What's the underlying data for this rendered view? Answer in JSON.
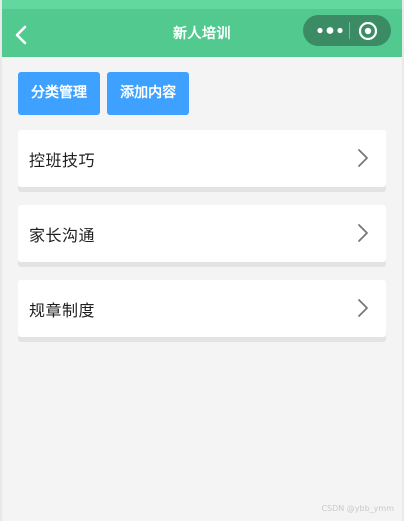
{
  "navbar": {
    "title": "新人培训",
    "back_icon": "chevron-left-icon",
    "more_icon": "more-dots-icon",
    "target_icon": "target-icon",
    "background": "#52c98f"
  },
  "actions": [
    {
      "label": "分类管理"
    },
    {
      "label": "添加内容"
    }
  ],
  "list": {
    "items": [
      {
        "label": "控班技巧",
        "icon": "chevron-right-icon"
      },
      {
        "label": "家长沟通",
        "icon": "chevron-right-icon"
      },
      {
        "label": "规章制度",
        "icon": "chevron-right-icon"
      }
    ]
  },
  "watermark": "CSDN @ybb_ymm",
  "colors": {
    "primary": "#3ea1ff",
    "navbar": "#52c98f",
    "background": "#f4f4f4"
  }
}
